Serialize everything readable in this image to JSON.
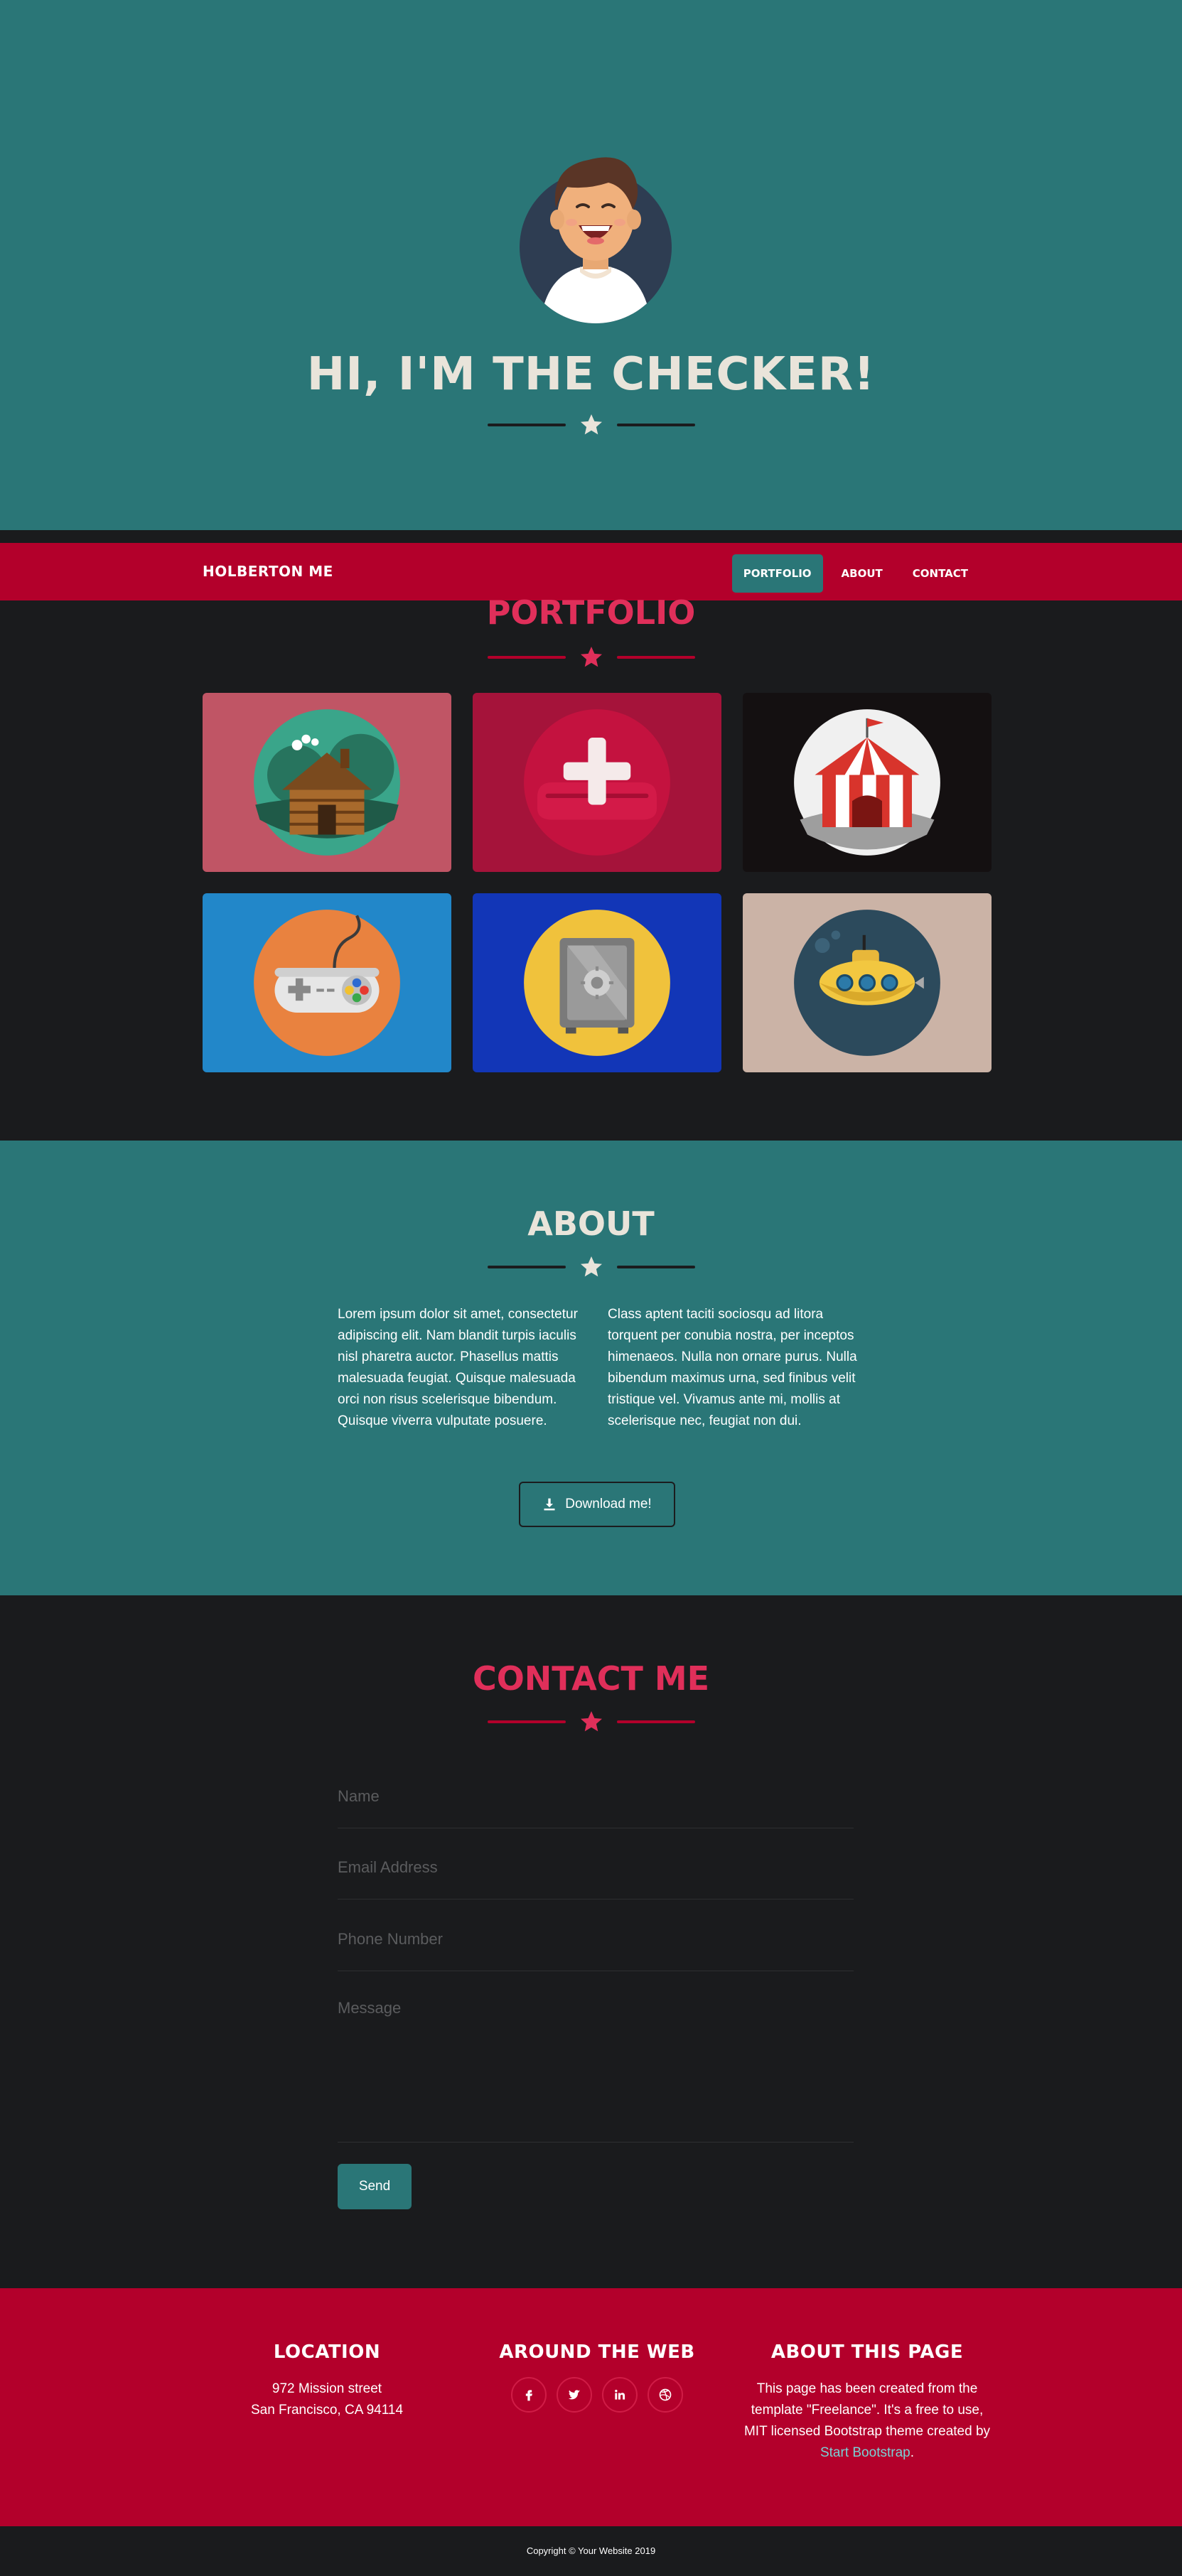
{
  "hero": {
    "title": "HI, I'M THE CHECKER!"
  },
  "navbar": {
    "brand": "HOLBERTON ME",
    "items": [
      {
        "label": "PORTFOLIO",
        "active": true
      },
      {
        "label": "ABOUT",
        "active": false
      },
      {
        "label": "CONTACT",
        "active": false
      }
    ]
  },
  "portfolio": {
    "title": "PORTFOLIO",
    "items": [
      {
        "name": "cabin-icon",
        "bg": "#c05565"
      },
      {
        "name": "cake-icon",
        "bg": "#a5133a"
      },
      {
        "name": "circus-icon",
        "bg": "#141011"
      },
      {
        "name": "game-controller-icon",
        "bg": "#2287c9"
      },
      {
        "name": "safe-icon",
        "bg": "#1236b7"
      },
      {
        "name": "submarine-icon",
        "bg": "#cbb3a6"
      }
    ]
  },
  "about": {
    "title": "ABOUT",
    "left_text": "Lorem ipsum dolor sit amet, consectetur adipiscing elit. Nam blandit turpis iaculis nisl pharetra auctor. Phasellus mattis malesuada feugiat. Quisque malesuada orci non risus scelerisque bibendum. Quisque viverra vulputate posuere.",
    "right_text": "Class aptent taciti sociosqu ad litora torquent per conubia nostra, per inceptos himenaeos. Nulla non ornare purus. Nulla bibendum maximus urna, sed finibus velit tristique vel. Vivamus ante mi, mollis at scelerisque nec, feugiat non dui.",
    "download_label": "Download me!"
  },
  "contact": {
    "title": "CONTACT ME",
    "name_placeholder": "Name",
    "email_placeholder": "Email Address",
    "phone_placeholder": "Phone Number",
    "message_placeholder": "Message",
    "send_label": "Send"
  },
  "footer": {
    "location": {
      "title": "LOCATION",
      "line1": "972 Mission street",
      "line2": "San Francisco, CA 94114"
    },
    "web": {
      "title": "AROUND THE WEB",
      "icons": [
        "facebook-icon",
        "twitter-icon",
        "linkedin-icon",
        "dribbble-icon"
      ]
    },
    "about_page": {
      "title": "ABOUT THIS PAGE",
      "text": "This page has been created from the template \"Freelance\". It's a free to use, MIT licensed Bootstrap theme created by",
      "link": "Start Bootstrap",
      "suffix": "."
    }
  },
  "copyright": "Copyright © Your Website 2019",
  "colors": {
    "teal": "#2a7677",
    "crimson": "#b3002b",
    "pink": "#e02f5a",
    "dark": "#1a1b1d",
    "cream": "#e9e4da"
  }
}
